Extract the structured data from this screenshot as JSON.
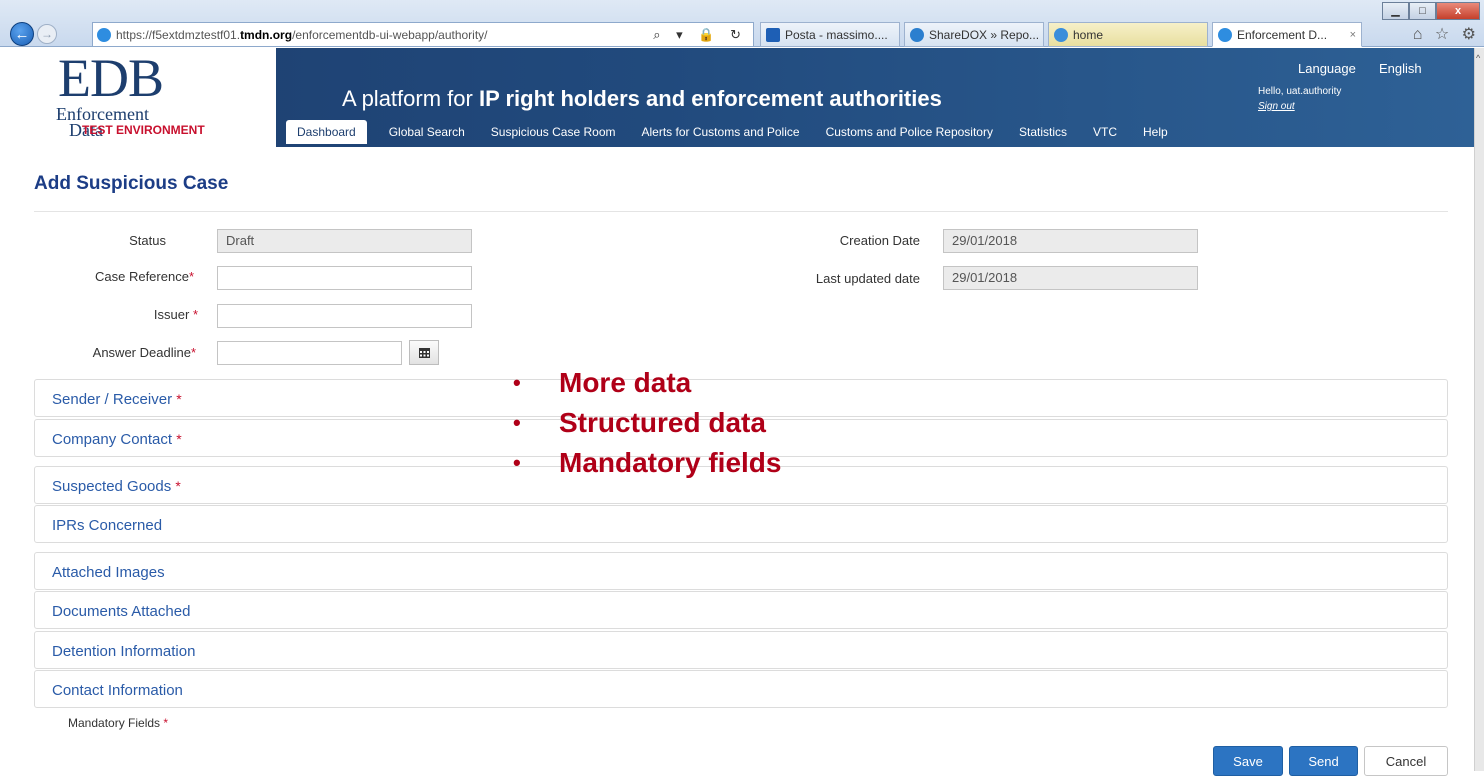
{
  "browser": {
    "url_prefix": "https://f5extdmztestf01.",
    "url_host": "tmdn.org",
    "url_path": "/enforcementdb-ui-webapp/authority/",
    "address_tools": "⌕ ▾ 🔒 ↻",
    "tabs": [
      {
        "label": "Posta - massimo....",
        "icon_color": "#1e5fb5",
        "icon": "outlook-icon"
      },
      {
        "label": "ShareDOX » Repo...",
        "icon_color": "#2b7fcf",
        "icon": "sharedox-icon"
      },
      {
        "label": "home",
        "icon_color": "#3a8edb",
        "icon": "page-icon"
      },
      {
        "label": "Enforcement D...",
        "icon_color": "#2e8de0",
        "icon": "ie-icon",
        "close": "×"
      }
    ],
    "window_controls": {
      "minimize": "▁",
      "maximize": "□",
      "close": "x"
    },
    "chrome_icons": "⌂ ☆ ⚙"
  },
  "header": {
    "logo_main": "EDB",
    "logo_sub_1": "Enforcement",
    "logo_sub_2": "Data",
    "logo_env": "TEST ENVIRONMENT",
    "tagline_pre": "A platform for ",
    "tagline_bold": "IP right holders and enforcement authorities",
    "language_label": "Language",
    "language_value": "English",
    "hello_text": "Hello, uat.authority",
    "signout_text": "Sign out",
    "menu": [
      "Dashboard",
      "Global Search",
      "Suspicious Case Room",
      "Alerts for Customs and Police",
      "Customs and Police Repository",
      "Statistics",
      "VTC",
      "Help"
    ],
    "active_menu": "Dashboard"
  },
  "page": {
    "title": "Add Suspicious Case",
    "form": {
      "status_label": "Status",
      "status_value": "Draft",
      "case_reference_label": "Case Reference",
      "case_reference_value": "",
      "issuer_label": "Issuer",
      "issuer_value": "",
      "answer_deadline_label": "Answer Deadline",
      "answer_deadline_value": "",
      "creation_date_label": "Creation Date",
      "creation_date_value": "29/01/2018",
      "last_updated_label": "Last updated date",
      "last_updated_value": "29/01/2018",
      "required_marker": "*"
    },
    "panels": [
      {
        "title": "Sender / Receiver",
        "required": true
      },
      {
        "title": "Company Contact",
        "required": true
      },
      {
        "title": "Suspected Goods",
        "required": true
      },
      {
        "title": "IPRs Concerned",
        "required": false
      },
      {
        "title": "Attached Images",
        "required": false
      },
      {
        "title": "Documents Attached",
        "required": false
      },
      {
        "title": "Detention Information",
        "required": false
      },
      {
        "title": "Contact Information",
        "required": false
      }
    ],
    "overlay_bullets": [
      "More data",
      "Structured data",
      "Mandatory fields"
    ],
    "mandatory_note": "Mandatory Fields",
    "buttons": {
      "save": "Save",
      "send": "Send",
      "cancel": "Cancel"
    }
  }
}
